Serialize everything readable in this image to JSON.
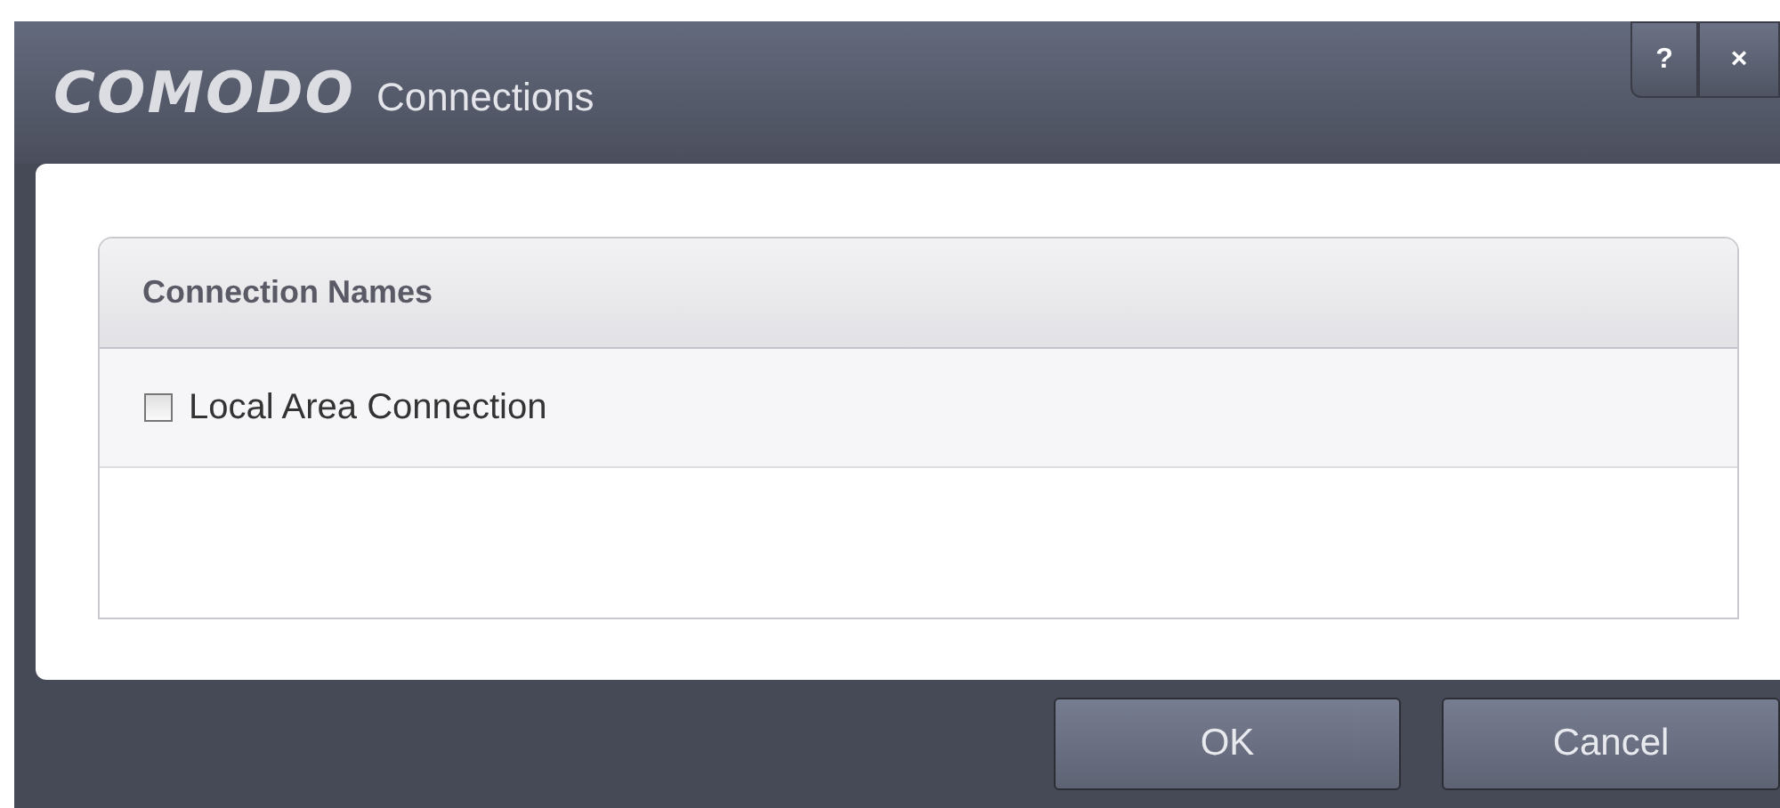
{
  "window": {
    "logo": "COMODO",
    "title": "Connections",
    "title_buttons": [
      "?",
      "×"
    ]
  },
  "table": {
    "header": "Connection Names",
    "rows": [
      {
        "label": "Local Area Connection",
        "checked": false
      }
    ]
  },
  "buttons": [
    "OK",
    "Cancel"
  ]
}
